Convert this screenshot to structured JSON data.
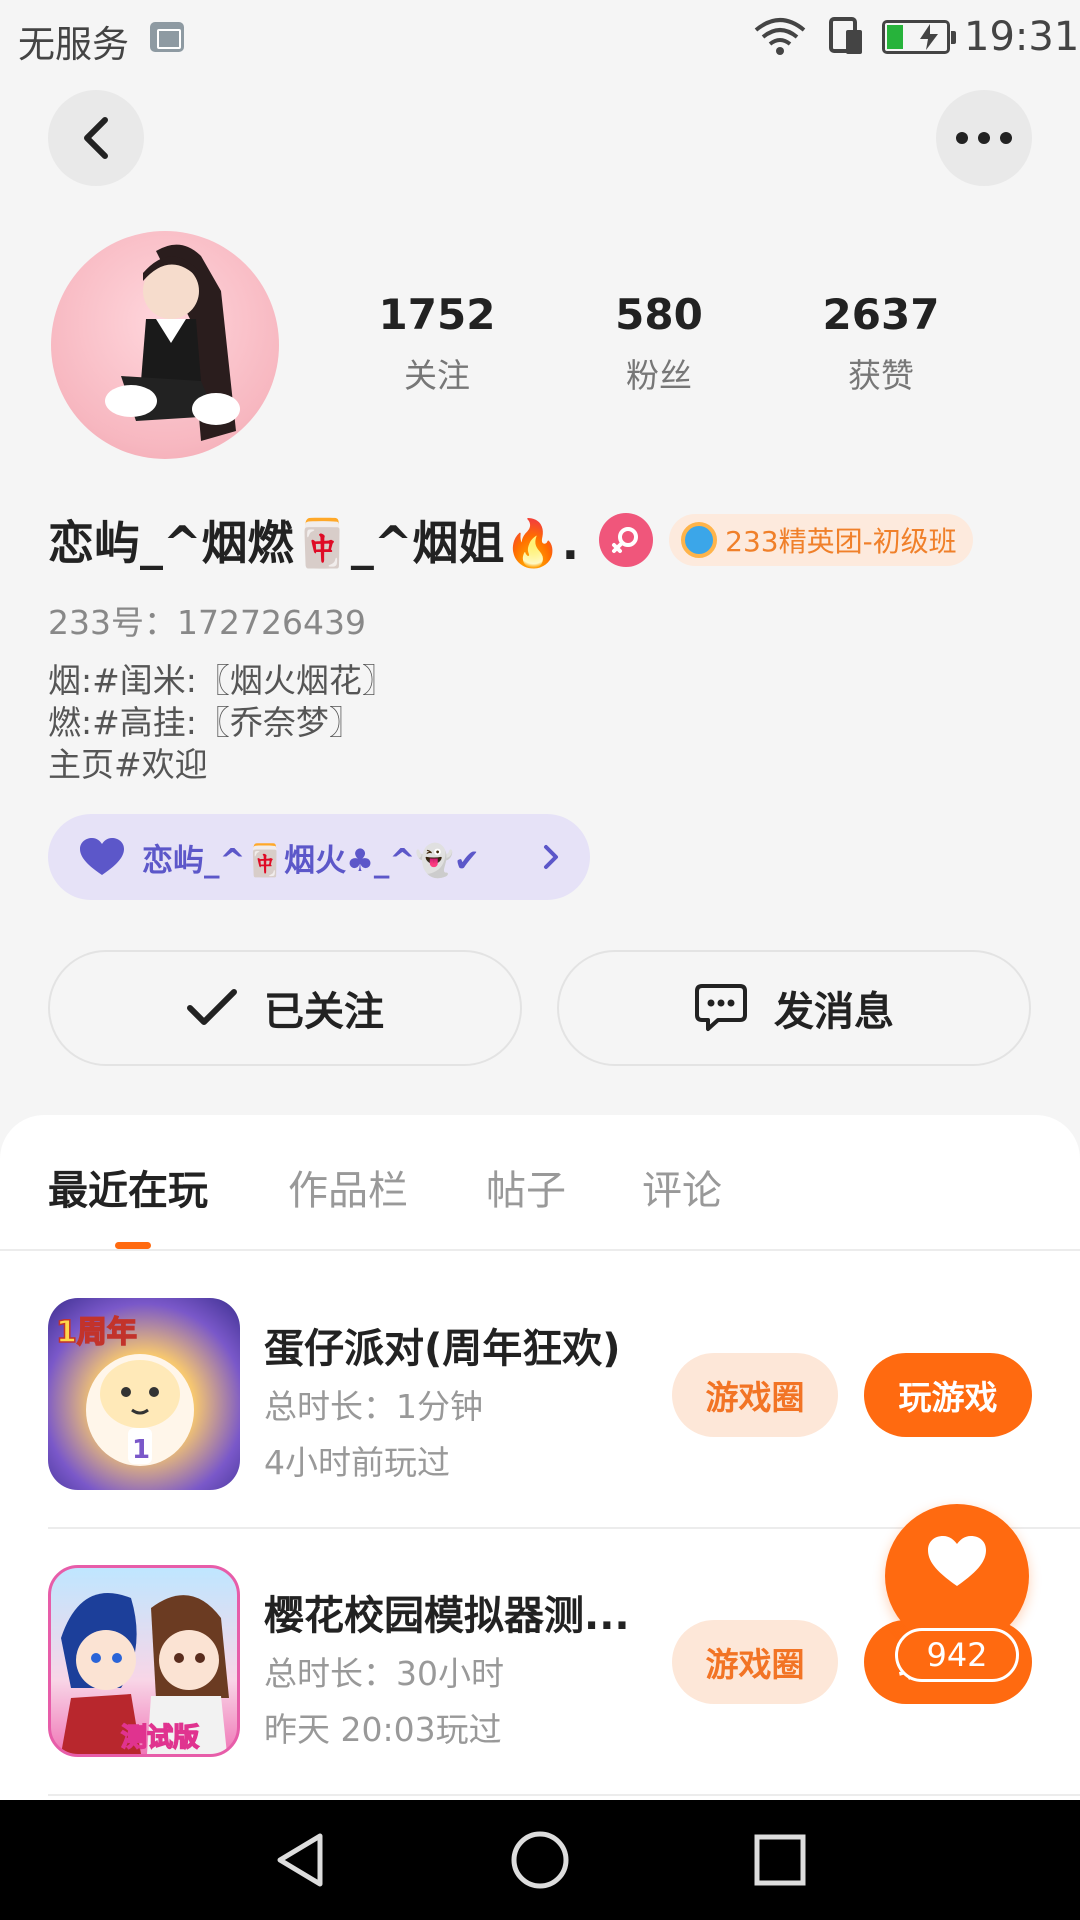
{
  "status_bar": {
    "carrier": "无服务",
    "time": "19:31"
  },
  "profile": {
    "stats": [
      {
        "value": "1752",
        "label": "关注"
      },
      {
        "value": "580",
        "label": "粉丝"
      },
      {
        "value": "2637",
        "label": "获赞"
      }
    ],
    "name": "恋屿_^烟燃🀄_^烟姐🔥.",
    "badge": "233精英团-初级班",
    "uid": "233号：172726439",
    "bio": [
      "烟:#闺米:〖烟火烟花〗",
      "燃:#高挂:〖乔奈梦〗",
      "主页#欢迎"
    ],
    "fan_group": "恋屿_^🀄烟火♣_^👻✔"
  },
  "actions": {
    "follow": "已关注",
    "message": "发消息"
  },
  "tabs": [
    {
      "label": "最近在玩",
      "active": true
    },
    {
      "label": "作品栏",
      "active": false
    },
    {
      "label": "帖子",
      "active": false
    },
    {
      "label": "评论",
      "active": false
    }
  ],
  "games": [
    {
      "title": "蛋仔派对(周年狂欢)",
      "duration": "总时长：1分钟",
      "last_played": "4小时前玩过",
      "circle_label": "游戏圈",
      "play_label": "玩游戏",
      "icon_tag": "1周年"
    },
    {
      "title": "樱花校园模拟器测...",
      "duration": "总时长：30小时",
      "last_played": "昨天 20:03玩过",
      "circle_label": "游戏圈",
      "play_label": "玩游戏",
      "icon_tag": "测试版"
    }
  ],
  "like_fab": {
    "count": "942"
  },
  "colors": {
    "accent": "#ff6a10",
    "badge_text": "#f0802a",
    "fan_pill_text": "#5c57c9"
  }
}
